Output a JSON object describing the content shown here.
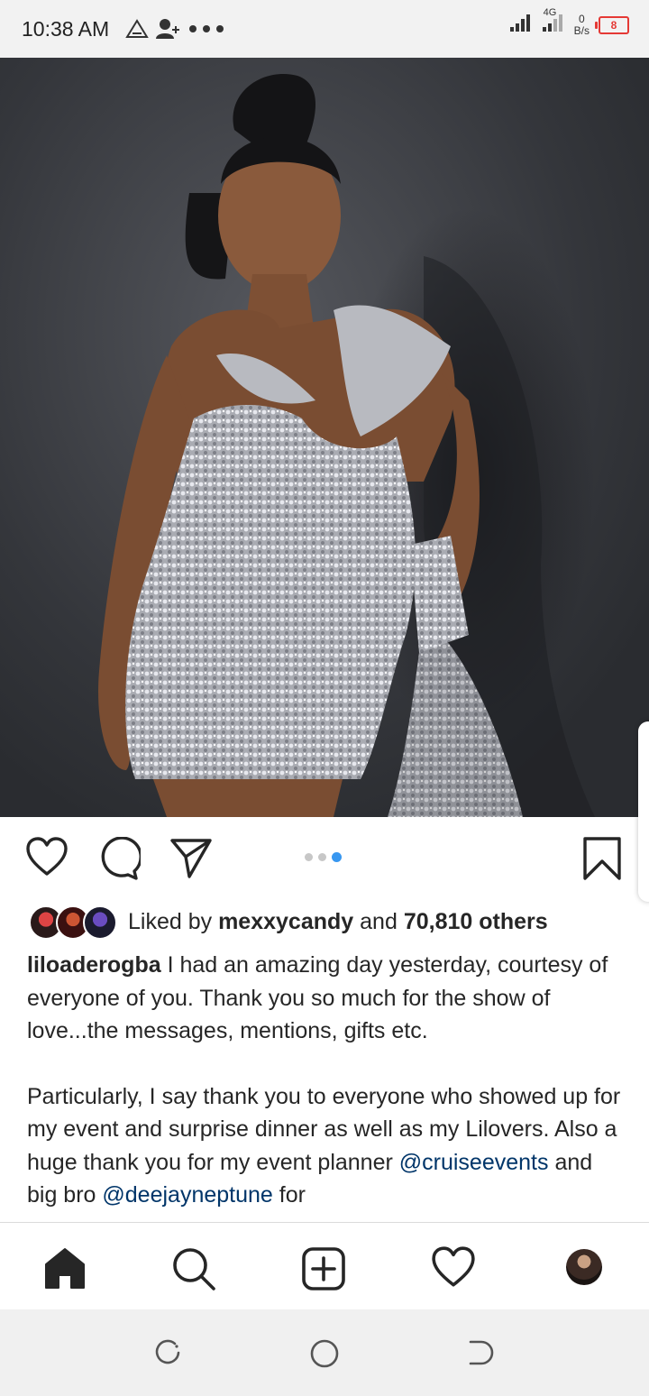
{
  "status_bar": {
    "time": "10:38 AM",
    "network_type": "4G",
    "speed_value": "0",
    "speed_unit": "B/s",
    "battery": "8"
  },
  "post": {
    "image_icon": "photo-of-woman-in-sequin-dress",
    "carousel": {
      "count": 3,
      "active_index": 3
    },
    "likes": {
      "prefix": "Liked by",
      "user": "mexxycandy",
      "middle": "and",
      "others": "70,810 others"
    },
    "caption": {
      "username": "liloaderogba",
      "line1": " I had an amazing day yesterday, courtesy of everyone of you. Thank you so much for the show of love...the messages, mentions, gifts etc.",
      "para2": "Particularly, I say thank you to everyone who showed up for my event and surprise dinner as well as my Lilovers. Also a huge thank you for my event planner",
      "mention1": "@cruiseevents",
      "mid": " and big bro ",
      "mention2": "@deejayneptune",
      "tail": " for"
    }
  },
  "bottom_nav": [
    "home-icon",
    "search-icon",
    "new-post-icon",
    "activity-heart-icon",
    "profile-avatar"
  ],
  "system_nav": [
    "recents-icon",
    "home-circle-icon",
    "back-icon"
  ],
  "colors": {
    "accent": "#3897f0",
    "mention": "#003569",
    "battery_low": "#e53935"
  }
}
